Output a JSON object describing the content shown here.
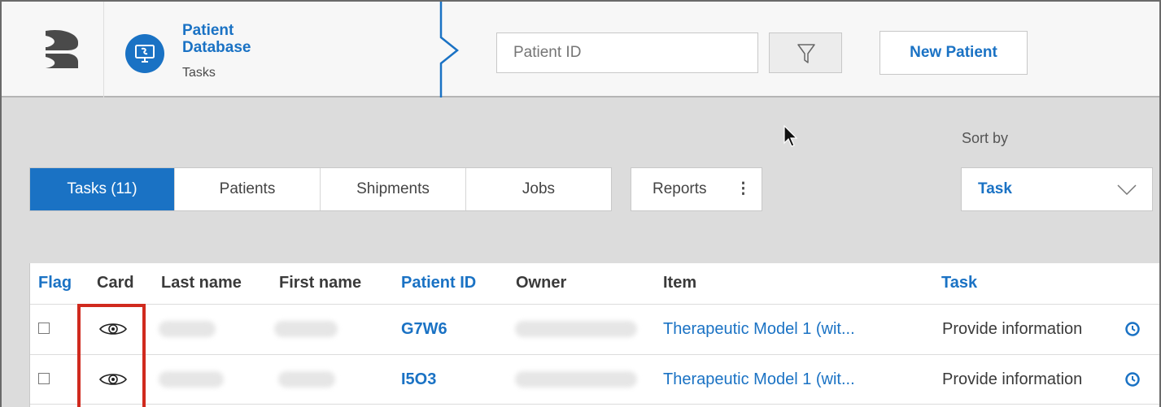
{
  "header": {
    "app_title_line1": "Patient",
    "app_title_line2": "Database",
    "app_subtitle": "Tasks",
    "search_placeholder": "Patient ID",
    "new_patient_label": "New Patient"
  },
  "toolbar": {
    "tabs": [
      {
        "label": "Tasks (11)",
        "active": true
      },
      {
        "label": "Patients",
        "active": false
      },
      {
        "label": "Shipments",
        "active": false
      },
      {
        "label": "Jobs",
        "active": false
      }
    ],
    "reports_label": "Reports",
    "reports_dots": "⋮",
    "sort_label": "Sort by",
    "sort_value": "Task"
  },
  "table": {
    "columns": [
      "Flag",
      "Card",
      "Last name",
      "First name",
      "Patient ID",
      "Owner",
      "Item",
      "Task"
    ],
    "rows": [
      {
        "patient_id": "G7W6",
        "item": "Therapeutic Model 1 (wit...",
        "task": "Provide information"
      },
      {
        "patient_id": "I5O3",
        "item": "Therapeutic Model 1 (wit...",
        "task": "Provide information"
      }
    ]
  },
  "colors": {
    "accent": "#1a72c4",
    "highlight": "#d02a1e"
  },
  "icons": [
    "brand-logo-icon",
    "app-monitor-icon",
    "filter-funnel-icon",
    "chevron-down-icon",
    "eye-icon",
    "clock-icon",
    "mouse-cursor-icon"
  ]
}
